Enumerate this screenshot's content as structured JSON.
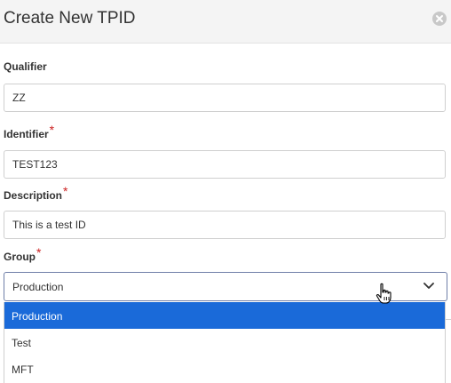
{
  "dialog": {
    "title": "Create New TPID",
    "close_icon": "close-circle-icon"
  },
  "form": {
    "qualifier": {
      "label": "Qualifier",
      "value": "ZZ"
    },
    "identifier": {
      "label": "Identifier",
      "required_mark": "*",
      "value": "TEST123"
    },
    "description": {
      "label": "Description",
      "required_mark": "*",
      "value": "This is a test ID"
    },
    "group": {
      "label": "Group",
      "required_mark": "*",
      "selected": "Production",
      "chevron_icon": "chevron-down-icon",
      "options": [
        {
          "label": "Production"
        },
        {
          "label": "Test"
        },
        {
          "label": "MFT"
        }
      ]
    }
  },
  "colors": {
    "header_bg": "#f4f4f4",
    "selected_option_bg": "#1a6ad9",
    "required_mark": "#cc2222"
  },
  "cursor_icon": "hand-pointer-icon"
}
